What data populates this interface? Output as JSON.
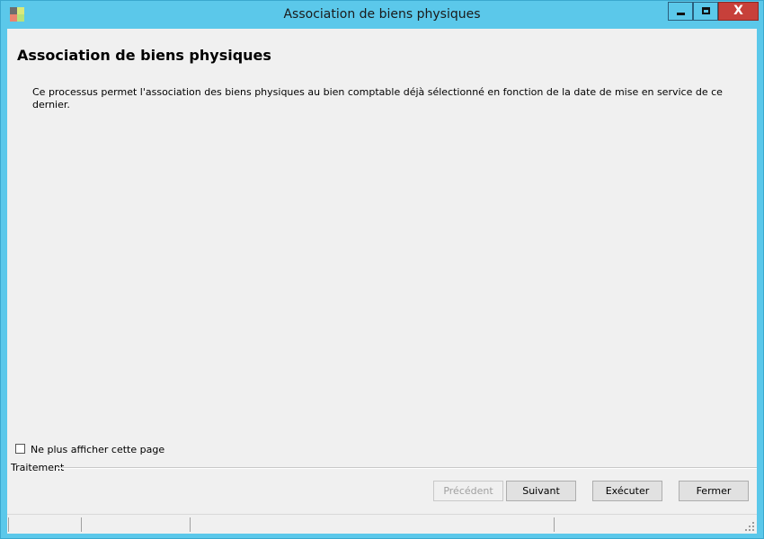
{
  "window": {
    "title": "Association de biens physiques",
    "caption_buttons": {
      "minimize_icon": "minimize-icon",
      "maximize_icon": "maximize-icon",
      "close_icon": "close-icon",
      "close_glyph": "X"
    },
    "accent_color": "#5bc8ea",
    "close_color": "#c7403a"
  },
  "page": {
    "title": "Association de biens physiques",
    "description": "Ce processus permet l'association des biens physiques au bien comptable déjà sélectionné en fonction de la date de mise en service de ce dernier."
  },
  "options": {
    "dont_show_again_label": "Ne plus afficher cette page",
    "dont_show_again_checked": false
  },
  "group": {
    "label": "Traitement"
  },
  "buttons": {
    "previous": "Précédent",
    "previous_enabled": false,
    "next": "Suivant",
    "execute": "Exécuter",
    "close": "Fermer"
  },
  "statusbar": {
    "panels": [
      "",
      "",
      "",
      ""
    ],
    "grip_icon": "resize-grip-icon"
  }
}
